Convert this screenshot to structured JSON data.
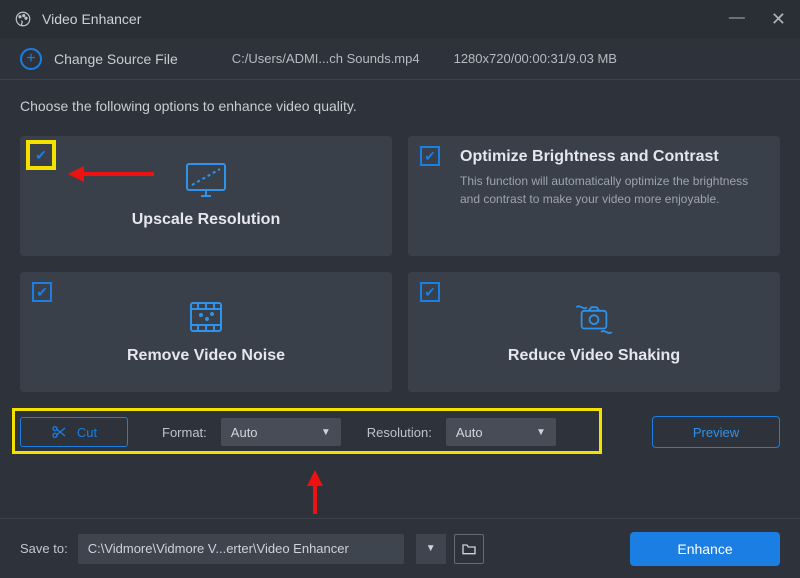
{
  "window": {
    "title": "Video Enhancer"
  },
  "source": {
    "change_label": "Change Source File",
    "path": "C:/Users/ADMI...ch Sounds.mp4",
    "info": "1280x720/00:00:31/9.03 MB"
  },
  "main": {
    "instruction": "Choose the following options to enhance video quality.",
    "cards": {
      "upscale": {
        "title": "Upscale Resolution"
      },
      "brightness": {
        "title": "Optimize Brightness and Contrast",
        "desc": "This function will automatically optimize the brightness and contrast to make your video more enjoyable."
      },
      "denoise": {
        "title": "Remove Video Noise"
      },
      "stabilize": {
        "title": "Reduce Video Shaking"
      }
    }
  },
  "controls": {
    "cut_label": "Cut",
    "format_label": "Format:",
    "format_value": "Auto",
    "resolution_label": "Resolution:",
    "resolution_value": "Auto",
    "preview_label": "Preview"
  },
  "bottom": {
    "save_label": "Save to:",
    "save_path": "C:\\Vidmore\\Vidmore V...erter\\Video Enhancer",
    "enhance_label": "Enhance"
  },
  "colors": {
    "accent": "#1a7ee2",
    "highlight": "#f5e100",
    "arrow": "#e01818"
  }
}
